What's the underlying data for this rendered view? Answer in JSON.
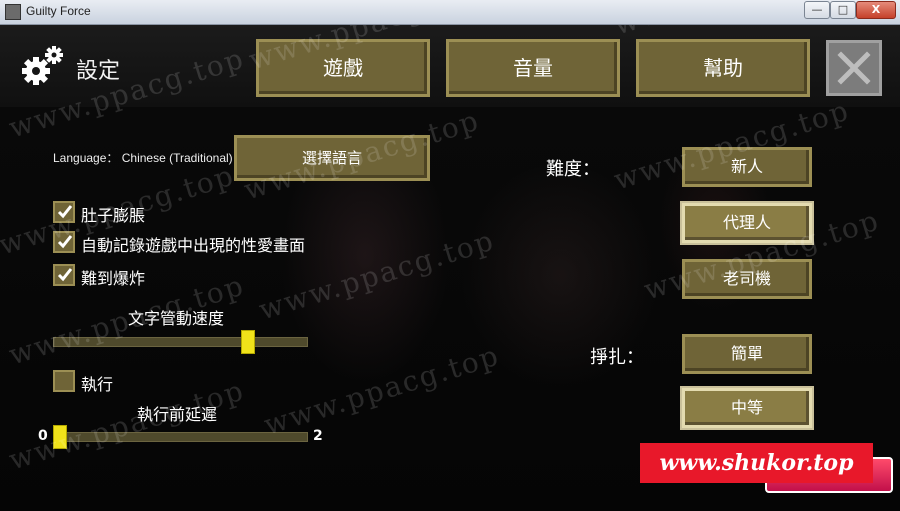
{
  "window": {
    "title": "Guilty Force",
    "controls": {
      "minimize": "—",
      "maximize": "□",
      "close": "X"
    }
  },
  "header": {
    "settings_label": "設定",
    "tabs": [
      {
        "label": "遊戲"
      },
      {
        "label": "音量"
      },
      {
        "label": "幫助"
      }
    ],
    "close_icon": "x-icon"
  },
  "language": {
    "label": "Language： Chinese (Traditional)",
    "select_button": "選擇語言"
  },
  "options": [
    {
      "label": "肚子膨脹",
      "checked": true
    },
    {
      "label": "自動記錄遊戲中出現的性愛畫面",
      "checked": true
    },
    {
      "label": "難到爆炸",
      "checked": true
    }
  ],
  "text_speed": {
    "label": "文字管動速度",
    "value": 0.78
  },
  "execute": {
    "label": "執行",
    "checked": false
  },
  "delay": {
    "label": "執行前延遲",
    "min_label": "0",
    "max_label": "2",
    "value": 0
  },
  "difficulty": {
    "label": "難度：",
    "options": [
      "新人",
      "代理人",
      "老司機"
    ],
    "selected": "代理人"
  },
  "struggle": {
    "label": "掙扎：",
    "options": [
      "簡單",
      "中等"
    ],
    "selected": "中等"
  },
  "watermark": {
    "text": "www.ppacg.top",
    "banner": "www.shukor.top"
  },
  "colors": {
    "button_fill": "#6f6437",
    "button_border": "#9c8f54",
    "slider_handle": "#f0e21a",
    "banner": "#e8182a"
  }
}
